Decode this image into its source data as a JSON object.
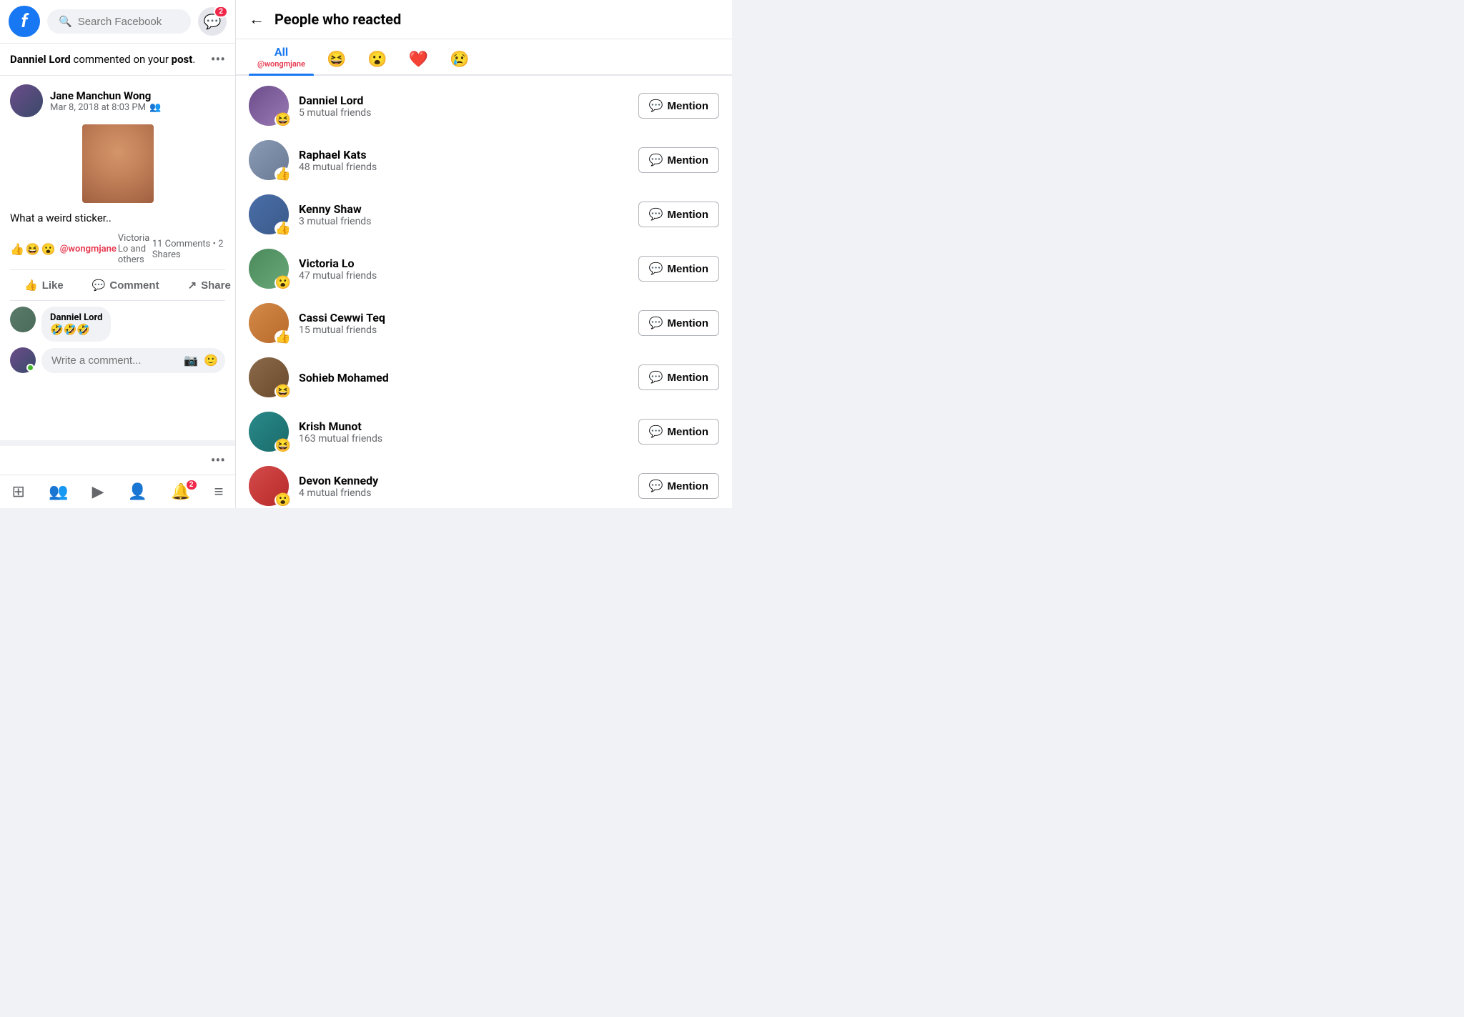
{
  "header": {
    "search_placeholder": "Search Facebook",
    "messenger_badge": "2",
    "fb_logo": "f"
  },
  "notification": {
    "text_before": "Danniel Lord",
    "text_after": " commented on your ",
    "link": "post",
    "text_end": "."
  },
  "post": {
    "author": "Jane Manchun Wong",
    "time": "Mar 8, 2018 at 8:03 PM",
    "caption": "What a weird sticker..",
    "mention": "@wongmjane",
    "reaction_users": "Victoria Lo and others",
    "reaction_mention": "@wongmjane",
    "comments_count": "11 Comments",
    "shares_count": "2 Shares",
    "like_label": "Like",
    "comment_label": "Comment",
    "share_label": "Share",
    "comment_author": "Danniel Lord",
    "comment_text": "🤣🤣🤣",
    "comment_placeholder": "Write a comment..."
  },
  "right_panel": {
    "back_label": "←",
    "title": "People who reacted",
    "tabs": [
      {
        "id": "all",
        "label": "All",
        "mention": "@wongmjane",
        "active": true
      },
      {
        "id": "haha",
        "emoji": "😆",
        "active": false
      },
      {
        "id": "wow",
        "emoji": "😮",
        "active": false
      },
      {
        "id": "heart",
        "emoji": "❤️",
        "active": false
      },
      {
        "id": "sad",
        "emoji": "😢",
        "active": false
      }
    ],
    "people": [
      {
        "name": "Danniel Lord",
        "mutual": "5 mutual friends",
        "reaction": "😆",
        "avatar_class": "av-purple",
        "mention_label": "Mention"
      },
      {
        "name": "Raphael Kats",
        "mutual": "48 mutual friends",
        "reaction": "👍",
        "avatar_class": "av-gray",
        "mention_label": "Mention"
      },
      {
        "name": "Kenny Shaw",
        "mutual": "3 mutual friends",
        "reaction": "👍",
        "avatar_class": "av-blue",
        "mention_label": "Mention"
      },
      {
        "name": "Victoria Lo",
        "mutual": "47 mutual friends",
        "reaction": "😮",
        "avatar_class": "av-green",
        "mention_label": "Mention"
      },
      {
        "name": "Cassi Cewwi Teq",
        "mutual": "15 mutual friends",
        "reaction": "👍",
        "avatar_class": "av-orange",
        "mention_label": "Mention"
      },
      {
        "name": "Sohieb Mohamed",
        "mutual": "",
        "reaction": "😆",
        "avatar_class": "av-brown",
        "mention_label": "Mention"
      },
      {
        "name": "Krish Munot",
        "mutual": "163 mutual friends",
        "reaction": "😆",
        "avatar_class": "av-teal",
        "mention_label": "Mention"
      },
      {
        "name": "Devon Kennedy",
        "mutual": "4 mutual friends",
        "reaction": "😮",
        "avatar_class": "av-red",
        "mention_label": "Mention"
      }
    ]
  },
  "bottom_nav": {
    "items": [
      {
        "icon": "⊞",
        "name": "home"
      },
      {
        "icon": "👥",
        "name": "friends"
      },
      {
        "icon": "▶",
        "name": "video"
      },
      {
        "icon": "👤",
        "name": "profile"
      },
      {
        "icon": "🔔",
        "name": "notifications",
        "badge": "2"
      },
      {
        "icon": "≡",
        "name": "menu"
      }
    ]
  }
}
